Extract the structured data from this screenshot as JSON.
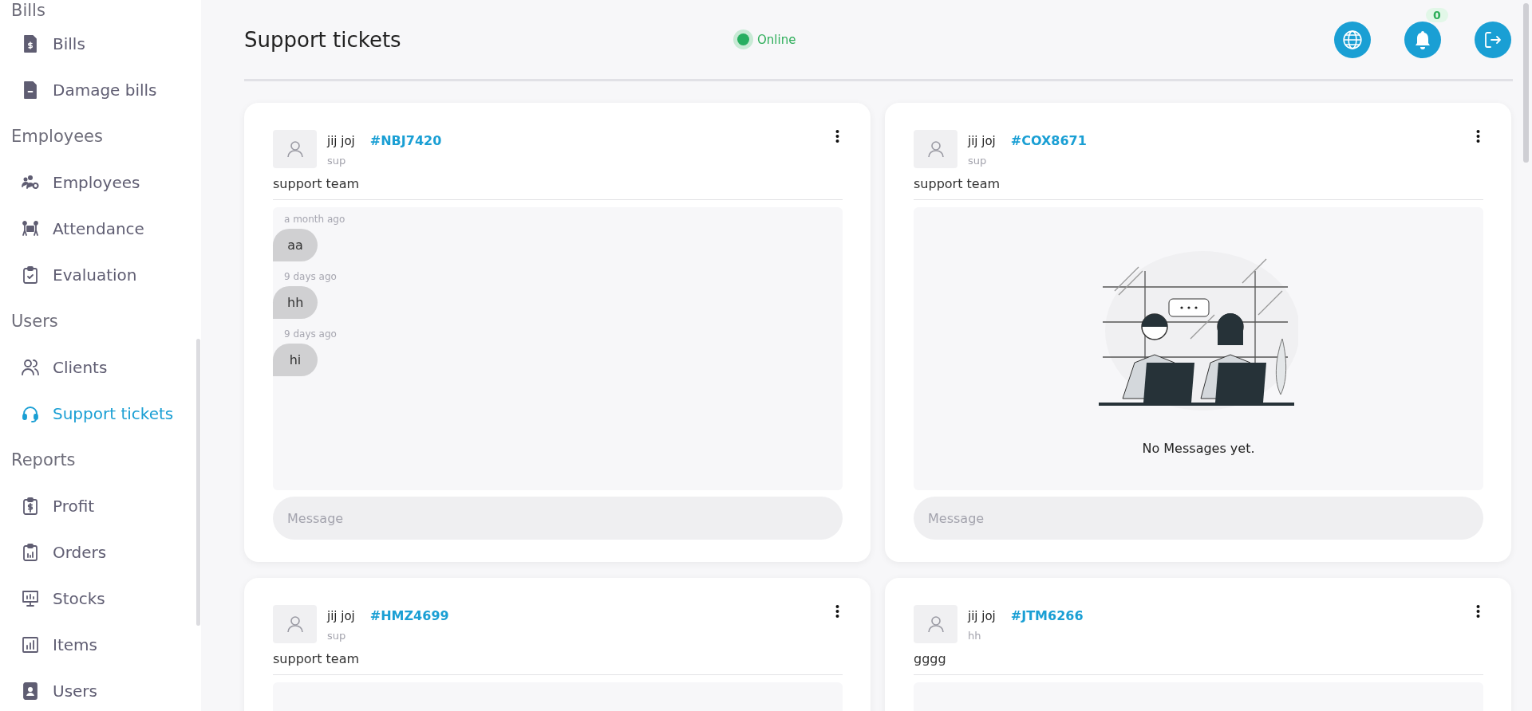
{
  "sidebar": {
    "sections": [
      {
        "heading": "Bills",
        "items": [
          {
            "label": "Bills",
            "selected": false
          },
          {
            "label": "Damage bills",
            "selected": false
          }
        ]
      },
      {
        "heading": "Employees",
        "items": [
          {
            "label": "Employees",
            "selected": false
          },
          {
            "label": "Attendance",
            "selected": false
          },
          {
            "label": "Evaluation",
            "selected": false
          }
        ]
      },
      {
        "heading": "Users",
        "items": [
          {
            "label": "Clients",
            "selected": false
          },
          {
            "label": "Support tickets",
            "selected": true
          }
        ]
      },
      {
        "heading": "Reports",
        "items": [
          {
            "label": "Profit",
            "selected": false
          },
          {
            "label": "Orders",
            "selected": false
          },
          {
            "label": "Stocks",
            "selected": false
          },
          {
            "label": "Items",
            "selected": false
          },
          {
            "label": "Users",
            "selected": false
          }
        ]
      }
    ]
  },
  "header": {
    "title": "Support tickets",
    "status": "Online",
    "online": true,
    "notifications": "0"
  },
  "tickets": [
    {
      "name": "jij joj",
      "code": "#NBJ7420",
      "role": "sup",
      "subject": "support team",
      "messages": [
        {
          "time": "a month ago",
          "text": "aa"
        },
        {
          "time": "9 days ago",
          "text": "hh"
        },
        {
          "time": "9 days ago",
          "text": "hi"
        }
      ],
      "placeholder": "Message"
    },
    {
      "name": "jij joj",
      "code": "#COX8671",
      "role": "sup",
      "subject": "support team",
      "empty_text": "No Messages yet.",
      "placeholder": "Message"
    },
    {
      "name": "jij joj",
      "code": "#HMZ4699",
      "role": "sup",
      "subject": "support team"
    },
    {
      "name": "jij joj",
      "code": "#JTM6266",
      "role": "hh",
      "subject": "gggg"
    }
  ]
}
